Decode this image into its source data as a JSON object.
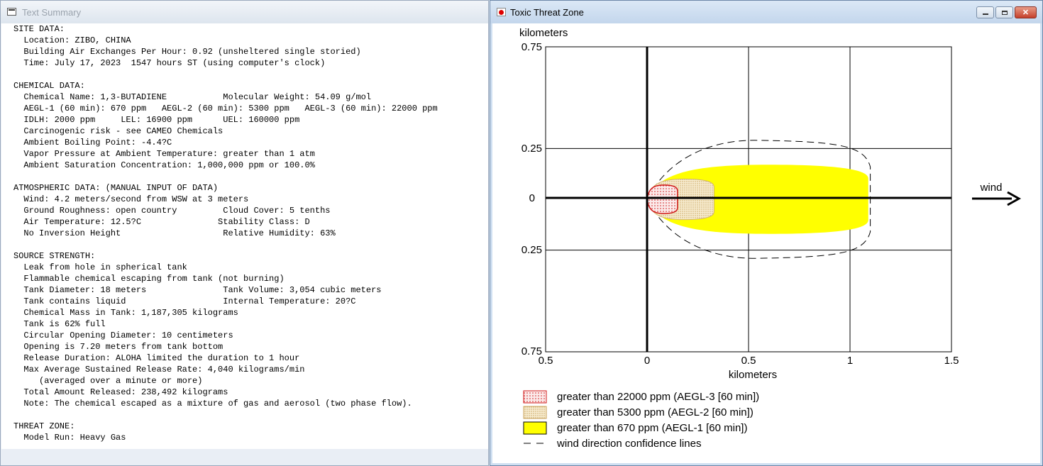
{
  "text_window": {
    "title": "Text Summary",
    "lines": [
      "SITE DATA:",
      "  Location: ZIBO, CHINA",
      "  Building Air Exchanges Per Hour: 0.92 (unsheltered single storied)",
      "  Time: July 17, 2023  1547 hours ST (using computer's clock)",
      "",
      "CHEMICAL DATA:",
      "  Chemical Name: 1,3-BUTADIENE           Molecular Weight: 54.09 g/mol",
      "  AEGL-1 (60 min): 670 ppm   AEGL-2 (60 min): 5300 ppm   AEGL-3 (60 min): 22000 ppm",
      "  IDLH: 2000 ppm     LEL: 16900 ppm      UEL: 160000 ppm",
      "  Carcinogenic risk - see CAMEO Chemicals",
      "  Ambient Boiling Point: -4.4?C",
      "  Vapor Pressure at Ambient Temperature: greater than 1 atm",
      "  Ambient Saturation Concentration: 1,000,000 ppm or 100.0%",
      "",
      "ATMOSPHERIC DATA: (MANUAL INPUT OF DATA)",
      "  Wind: 4.2 meters/second from WSW at 3 meters",
      "  Ground Roughness: open country         Cloud Cover: 5 tenths",
      "  Air Temperature: 12.5?C               Stability Class: D",
      "  No Inversion Height                    Relative Humidity: 63%",
      "",
      "SOURCE STRENGTH:",
      "  Leak from hole in spherical tank",
      "  Flammable chemical escaping from tank (not burning)",
      "  Tank Diameter: 18 meters               Tank Volume: 3,054 cubic meters",
      "  Tank contains liquid                   Internal Temperature: 20?C",
      "  Chemical Mass in Tank: 1,187,305 kilograms",
      "  Tank is 62% full",
      "  Circular Opening Diameter: 10 centimeters",
      "  Opening is 7.20 meters from tank bottom",
      "  Release Duration: ALOHA limited the duration to 1 hour",
      "  Max Average Sustained Release Rate: 4,040 kilograms/min",
      "     (averaged over a minute or more)",
      "  Total Amount Released: 238,492 kilograms",
      "  Note: The chemical escaped as a mixture of gas and aerosol (two phase flow).",
      "",
      "THREAT ZONE:",
      "  Model Run: Heavy Gas"
    ]
  },
  "chart_window": {
    "title": "Toxic Threat Zone",
    "wind_label": "wind",
    "colors": {
      "aegl3_fill": "#f5dada",
      "aegl3_stroke": "#d01818",
      "aegl2_fill": "#f6e7c0",
      "aegl1_fill": "#ffff00"
    }
  },
  "chart_data": {
    "type": "area",
    "xlabel": "kilometers",
    "ylabel": "kilometers",
    "x_ticks": [
      "0.5",
      "0",
      "0.5",
      "1",
      "1.5"
    ],
    "y_ticks": [
      "0.75",
      "0.25",
      "0",
      "0.25",
      "0.75"
    ],
    "xlim": [
      -0.5,
      1.5
    ],
    "ylim": [
      -0.75,
      0.75
    ],
    "grid": true,
    "zones": [
      {
        "name": "greater than 22000 ppm (AEGL-3 [60 min])",
        "max_downwind_km": 0.15,
        "half_width_km": 0.07
      },
      {
        "name": "greater than 5300 ppm (AEGL-2 [60 min])",
        "max_downwind_km": 0.33,
        "half_width_km": 0.1
      },
      {
        "name": "greater than 670 ppm (AEGL-1 [60 min])",
        "max_downwind_km": 1.09,
        "half_width_km": 0.17
      }
    ],
    "confidence_lines": {
      "name": "wind direction confidence lines",
      "max_downwind_km": 1.1,
      "half_width_km": 0.29
    },
    "legend_position": "bottom"
  }
}
